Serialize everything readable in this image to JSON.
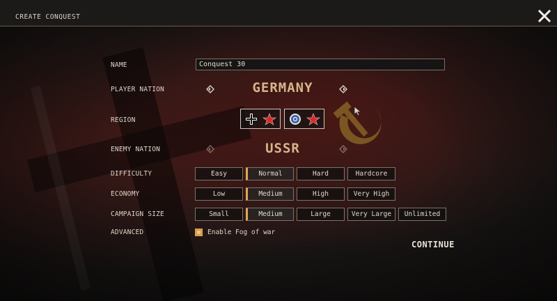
{
  "header": {
    "title": "CREATE CONQUEST"
  },
  "form": {
    "name_label": "NAME",
    "name_value": "Conquest 30",
    "player_nation_label": "PLAYER NATION",
    "player_nation": "GERMANY",
    "region_label": "REGION",
    "regions": [
      {
        "icon": "german-cross-soviet-star-icon"
      },
      {
        "icon": "raf-roundel-soviet-star-icon"
      }
    ],
    "enemy_nation_label": "ENEMY NATION",
    "enemy_nation": "USSR",
    "difficulty_label": "DIFFICULTY",
    "difficulty_options": [
      "Easy",
      "Normal",
      "Hard",
      "Hardcore"
    ],
    "difficulty_selected": "Normal",
    "economy_label": "ECONOMY",
    "economy_options": [
      "Low",
      "Medium",
      "High",
      "Very High"
    ],
    "economy_selected": "Medium",
    "campaign_size_label": "CAMPAIGN SIZE",
    "campaign_size_options": [
      "Small",
      "Medium",
      "Large",
      "Very Large",
      "Unlimited"
    ],
    "campaign_size_selected": "Medium",
    "advanced_label": "ADVANCED",
    "fog_of_war_label": "Enable Fog of war",
    "fog_of_war_checked": true
  },
  "actions": {
    "continue_label": "CONTINUE"
  },
  "colors": {
    "accent": "#e0a957",
    "nation_text": "#d8b48a",
    "star_red": "#d42a2a"
  }
}
